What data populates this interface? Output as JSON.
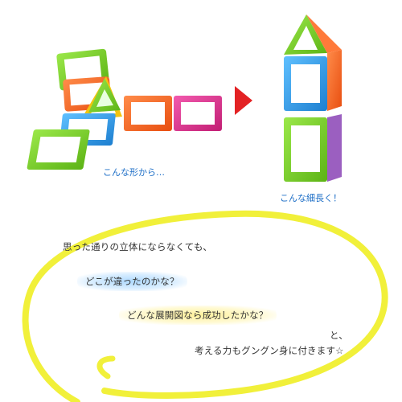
{
  "caption_left": "こんな形から…",
  "caption_right": "こんな細長く！",
  "lines": {
    "line1": "思った通りの立体にならなくても、",
    "line2": "どこが違ったのかな？",
    "line3": "どんな展開図なら成功したかな？",
    "line4": "と、",
    "line5": "考える力もグングン身に付きます☆"
  },
  "colors": {
    "green": "#7ed321",
    "blue": "#2f9be8",
    "orange": "#ff6a2a",
    "magenta": "#e0338f",
    "yellow": "#f2c40f",
    "purple": "#9b5fc0",
    "arrow": "#e32224",
    "ellipse": "#f1f03a",
    "caption": "#1e6fc7"
  },
  "icons": {
    "arrow": "right-arrow-icon"
  }
}
